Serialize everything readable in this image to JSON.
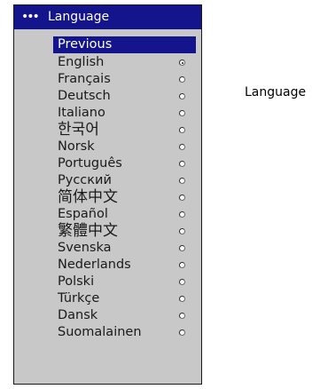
{
  "menu": {
    "header_icon": "dots-icon",
    "header_dots": "•••",
    "title": "Language",
    "items": [
      {
        "label": "Previous",
        "active": true
      },
      {
        "label": "English",
        "checked": true
      },
      {
        "label": "Français",
        "checked": false
      },
      {
        "label": "Deutsch",
        "checked": false
      },
      {
        "label": "Italiano",
        "checked": false
      },
      {
        "label": "한국어",
        "checked": false
      },
      {
        "label": "Norsk",
        "checked": false
      },
      {
        "label": "Português",
        "checked": false
      },
      {
        "label": "Русский",
        "checked": false
      },
      {
        "label": "简体中文",
        "checked": false
      },
      {
        "label": "Español",
        "checked": false
      },
      {
        "label": "繁體中文",
        "checked": false
      },
      {
        "label": "Svenska",
        "checked": false
      },
      {
        "label": "Nederlands",
        "checked": false
      },
      {
        "label": "Polski",
        "checked": false
      },
      {
        "label": "Türkçe",
        "checked": false
      },
      {
        "label": "Dansk",
        "checked": false
      },
      {
        "label": "Suomalainen",
        "checked": false
      }
    ]
  },
  "side_label": "Language",
  "colors": {
    "header_bg": "#14148c",
    "menu_bg": "#c8c8c8",
    "text": "#1a1a1a"
  }
}
